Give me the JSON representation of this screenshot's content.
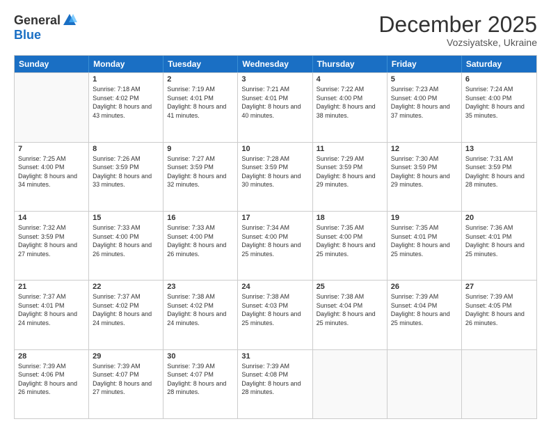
{
  "logo": {
    "general": "General",
    "blue": "Blue"
  },
  "title": "December 2025",
  "location": "Vozsiyatske, Ukraine",
  "days_of_week": [
    "Sunday",
    "Monday",
    "Tuesday",
    "Wednesday",
    "Thursday",
    "Friday",
    "Saturday"
  ],
  "weeks": [
    [
      {
        "day": "",
        "empty": true
      },
      {
        "day": "1",
        "sunrise": "7:18 AM",
        "sunset": "4:02 PM",
        "daylight": "8 hours and 43 minutes."
      },
      {
        "day": "2",
        "sunrise": "7:19 AM",
        "sunset": "4:01 PM",
        "daylight": "8 hours and 41 minutes."
      },
      {
        "day": "3",
        "sunrise": "7:21 AM",
        "sunset": "4:01 PM",
        "daylight": "8 hours and 40 minutes."
      },
      {
        "day": "4",
        "sunrise": "7:22 AM",
        "sunset": "4:00 PM",
        "daylight": "8 hours and 38 minutes."
      },
      {
        "day": "5",
        "sunrise": "7:23 AM",
        "sunset": "4:00 PM",
        "daylight": "8 hours and 37 minutes."
      },
      {
        "day": "6",
        "sunrise": "7:24 AM",
        "sunset": "4:00 PM",
        "daylight": "8 hours and 35 minutes."
      }
    ],
    [
      {
        "day": "7",
        "sunrise": "7:25 AM",
        "sunset": "4:00 PM",
        "daylight": "8 hours and 34 minutes."
      },
      {
        "day": "8",
        "sunrise": "7:26 AM",
        "sunset": "3:59 PM",
        "daylight": "8 hours and 33 minutes."
      },
      {
        "day": "9",
        "sunrise": "7:27 AM",
        "sunset": "3:59 PM",
        "daylight": "8 hours and 32 minutes."
      },
      {
        "day": "10",
        "sunrise": "7:28 AM",
        "sunset": "3:59 PM",
        "daylight": "8 hours and 30 minutes."
      },
      {
        "day": "11",
        "sunrise": "7:29 AM",
        "sunset": "3:59 PM",
        "daylight": "8 hours and 29 minutes."
      },
      {
        "day": "12",
        "sunrise": "7:30 AM",
        "sunset": "3:59 PM",
        "daylight": "8 hours and 29 minutes."
      },
      {
        "day": "13",
        "sunrise": "7:31 AM",
        "sunset": "3:59 PM",
        "daylight": "8 hours and 28 minutes."
      }
    ],
    [
      {
        "day": "14",
        "sunrise": "7:32 AM",
        "sunset": "3:59 PM",
        "daylight": "8 hours and 27 minutes."
      },
      {
        "day": "15",
        "sunrise": "7:33 AM",
        "sunset": "4:00 PM",
        "daylight": "8 hours and 26 minutes."
      },
      {
        "day": "16",
        "sunrise": "7:33 AM",
        "sunset": "4:00 PM",
        "daylight": "8 hours and 26 minutes."
      },
      {
        "day": "17",
        "sunrise": "7:34 AM",
        "sunset": "4:00 PM",
        "daylight": "8 hours and 25 minutes."
      },
      {
        "day": "18",
        "sunrise": "7:35 AM",
        "sunset": "4:00 PM",
        "daylight": "8 hours and 25 minutes."
      },
      {
        "day": "19",
        "sunrise": "7:35 AM",
        "sunset": "4:01 PM",
        "daylight": "8 hours and 25 minutes."
      },
      {
        "day": "20",
        "sunrise": "7:36 AM",
        "sunset": "4:01 PM",
        "daylight": "8 hours and 25 minutes."
      }
    ],
    [
      {
        "day": "21",
        "sunrise": "7:37 AM",
        "sunset": "4:01 PM",
        "daylight": "8 hours and 24 minutes."
      },
      {
        "day": "22",
        "sunrise": "7:37 AM",
        "sunset": "4:02 PM",
        "daylight": "8 hours and 24 minutes."
      },
      {
        "day": "23",
        "sunrise": "7:38 AM",
        "sunset": "4:02 PM",
        "daylight": "8 hours and 24 minutes."
      },
      {
        "day": "24",
        "sunrise": "7:38 AM",
        "sunset": "4:03 PM",
        "daylight": "8 hours and 25 minutes."
      },
      {
        "day": "25",
        "sunrise": "7:38 AM",
        "sunset": "4:04 PM",
        "daylight": "8 hours and 25 minutes."
      },
      {
        "day": "26",
        "sunrise": "7:39 AM",
        "sunset": "4:04 PM",
        "daylight": "8 hours and 25 minutes."
      },
      {
        "day": "27",
        "sunrise": "7:39 AM",
        "sunset": "4:05 PM",
        "daylight": "8 hours and 26 minutes."
      }
    ],
    [
      {
        "day": "28",
        "sunrise": "7:39 AM",
        "sunset": "4:06 PM",
        "daylight": "8 hours and 26 minutes."
      },
      {
        "day": "29",
        "sunrise": "7:39 AM",
        "sunset": "4:07 PM",
        "daylight": "8 hours and 27 minutes."
      },
      {
        "day": "30",
        "sunrise": "7:39 AM",
        "sunset": "4:07 PM",
        "daylight": "8 hours and 28 minutes."
      },
      {
        "day": "31",
        "sunrise": "7:39 AM",
        "sunset": "4:08 PM",
        "daylight": "8 hours and 28 minutes."
      },
      {
        "day": "",
        "empty": true
      },
      {
        "day": "",
        "empty": true
      },
      {
        "day": "",
        "empty": true
      }
    ]
  ],
  "labels": {
    "sunrise": "Sunrise:",
    "sunset": "Sunset:",
    "daylight": "Daylight:"
  }
}
